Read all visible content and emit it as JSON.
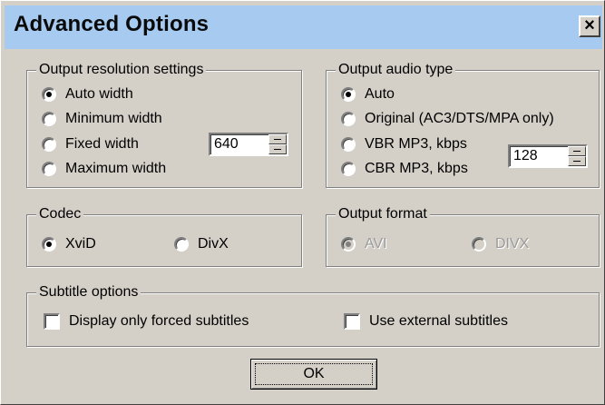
{
  "window": {
    "title": "Advanced Options",
    "close_label": "×"
  },
  "resolution": {
    "legend": "Output resolution settings",
    "options": [
      "Auto width",
      "Minimum width",
      "Fixed width",
      "Maximum width"
    ],
    "selected": "Auto width",
    "fixed_width_value": "640"
  },
  "audio": {
    "legend": "Output audio type",
    "options": [
      "Auto",
      "Original (AC3/DTS/MPA only)",
      "VBR MP3, kbps",
      "CBR MP3, kbps"
    ],
    "selected": "Auto",
    "bitrate_value": "128"
  },
  "codec": {
    "legend": "Codec",
    "options": [
      "XviD",
      "DivX"
    ],
    "selected": "XviD"
  },
  "format": {
    "legend": "Output format",
    "options": [
      "AVI",
      "DIVX"
    ],
    "selected": "AVI",
    "enabled": false
  },
  "subtitles": {
    "legend": "Subtitle options",
    "forced_label": "Display only forced subtitles",
    "forced_checked": false,
    "external_label": "Use external subtitles",
    "external_checked": false
  },
  "buttons": {
    "ok_label": "OK"
  }
}
